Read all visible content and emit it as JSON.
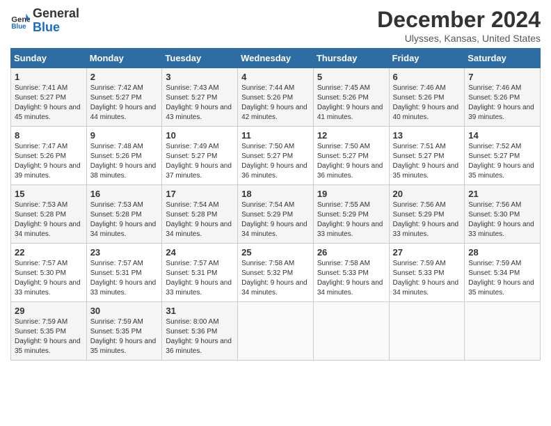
{
  "header": {
    "logo_line1": "General",
    "logo_line2": "Blue",
    "main_title": "December 2024",
    "subtitle": "Ulysses, Kansas, United States"
  },
  "columns": [
    "Sunday",
    "Monday",
    "Tuesday",
    "Wednesday",
    "Thursday",
    "Friday",
    "Saturday"
  ],
  "weeks": [
    [
      {
        "day": "1",
        "text": "Sunrise: 7:41 AM\nSunset: 5:27 PM\nDaylight: 9 hours and 45 minutes."
      },
      {
        "day": "2",
        "text": "Sunrise: 7:42 AM\nSunset: 5:27 PM\nDaylight: 9 hours and 44 minutes."
      },
      {
        "day": "3",
        "text": "Sunrise: 7:43 AM\nSunset: 5:27 PM\nDaylight: 9 hours and 43 minutes."
      },
      {
        "day": "4",
        "text": "Sunrise: 7:44 AM\nSunset: 5:26 PM\nDaylight: 9 hours and 42 minutes."
      },
      {
        "day": "5",
        "text": "Sunrise: 7:45 AM\nSunset: 5:26 PM\nDaylight: 9 hours and 41 minutes."
      },
      {
        "day": "6",
        "text": "Sunrise: 7:46 AM\nSunset: 5:26 PM\nDaylight: 9 hours and 40 minutes."
      },
      {
        "day": "7",
        "text": "Sunrise: 7:46 AM\nSunset: 5:26 PM\nDaylight: 9 hours and 39 minutes."
      }
    ],
    [
      {
        "day": "8",
        "text": "Sunrise: 7:47 AM\nSunset: 5:26 PM\nDaylight: 9 hours and 39 minutes."
      },
      {
        "day": "9",
        "text": "Sunrise: 7:48 AM\nSunset: 5:26 PM\nDaylight: 9 hours and 38 minutes."
      },
      {
        "day": "10",
        "text": "Sunrise: 7:49 AM\nSunset: 5:27 PM\nDaylight: 9 hours and 37 minutes."
      },
      {
        "day": "11",
        "text": "Sunrise: 7:50 AM\nSunset: 5:27 PM\nDaylight: 9 hours and 36 minutes."
      },
      {
        "day": "12",
        "text": "Sunrise: 7:50 AM\nSunset: 5:27 PM\nDaylight: 9 hours and 36 minutes."
      },
      {
        "day": "13",
        "text": "Sunrise: 7:51 AM\nSunset: 5:27 PM\nDaylight: 9 hours and 35 minutes."
      },
      {
        "day": "14",
        "text": "Sunrise: 7:52 AM\nSunset: 5:27 PM\nDaylight: 9 hours and 35 minutes."
      }
    ],
    [
      {
        "day": "15",
        "text": "Sunrise: 7:53 AM\nSunset: 5:28 PM\nDaylight: 9 hours and 34 minutes."
      },
      {
        "day": "16",
        "text": "Sunrise: 7:53 AM\nSunset: 5:28 PM\nDaylight: 9 hours and 34 minutes."
      },
      {
        "day": "17",
        "text": "Sunrise: 7:54 AM\nSunset: 5:28 PM\nDaylight: 9 hours and 34 minutes."
      },
      {
        "day": "18",
        "text": "Sunrise: 7:54 AM\nSunset: 5:29 PM\nDaylight: 9 hours and 34 minutes."
      },
      {
        "day": "19",
        "text": "Sunrise: 7:55 AM\nSunset: 5:29 PM\nDaylight: 9 hours and 33 minutes."
      },
      {
        "day": "20",
        "text": "Sunrise: 7:56 AM\nSunset: 5:29 PM\nDaylight: 9 hours and 33 minutes."
      },
      {
        "day": "21",
        "text": "Sunrise: 7:56 AM\nSunset: 5:30 PM\nDaylight: 9 hours and 33 minutes."
      }
    ],
    [
      {
        "day": "22",
        "text": "Sunrise: 7:57 AM\nSunset: 5:30 PM\nDaylight: 9 hours and 33 minutes."
      },
      {
        "day": "23",
        "text": "Sunrise: 7:57 AM\nSunset: 5:31 PM\nDaylight: 9 hours and 33 minutes."
      },
      {
        "day": "24",
        "text": "Sunrise: 7:57 AM\nSunset: 5:31 PM\nDaylight: 9 hours and 33 minutes."
      },
      {
        "day": "25",
        "text": "Sunrise: 7:58 AM\nSunset: 5:32 PM\nDaylight: 9 hours and 34 minutes."
      },
      {
        "day": "26",
        "text": "Sunrise: 7:58 AM\nSunset: 5:33 PM\nDaylight: 9 hours and 34 minutes."
      },
      {
        "day": "27",
        "text": "Sunrise: 7:59 AM\nSunset: 5:33 PM\nDaylight: 9 hours and 34 minutes."
      },
      {
        "day": "28",
        "text": "Sunrise: 7:59 AM\nSunset: 5:34 PM\nDaylight: 9 hours and 35 minutes."
      }
    ],
    [
      {
        "day": "29",
        "text": "Sunrise: 7:59 AM\nSunset: 5:35 PM\nDaylight: 9 hours and 35 minutes."
      },
      {
        "day": "30",
        "text": "Sunrise: 7:59 AM\nSunset: 5:35 PM\nDaylight: 9 hours and 35 minutes."
      },
      {
        "day": "31",
        "text": "Sunrise: 8:00 AM\nSunset: 5:36 PM\nDaylight: 9 hours and 36 minutes."
      },
      {
        "day": "",
        "text": ""
      },
      {
        "day": "",
        "text": ""
      },
      {
        "day": "",
        "text": ""
      },
      {
        "day": "",
        "text": ""
      }
    ]
  ]
}
